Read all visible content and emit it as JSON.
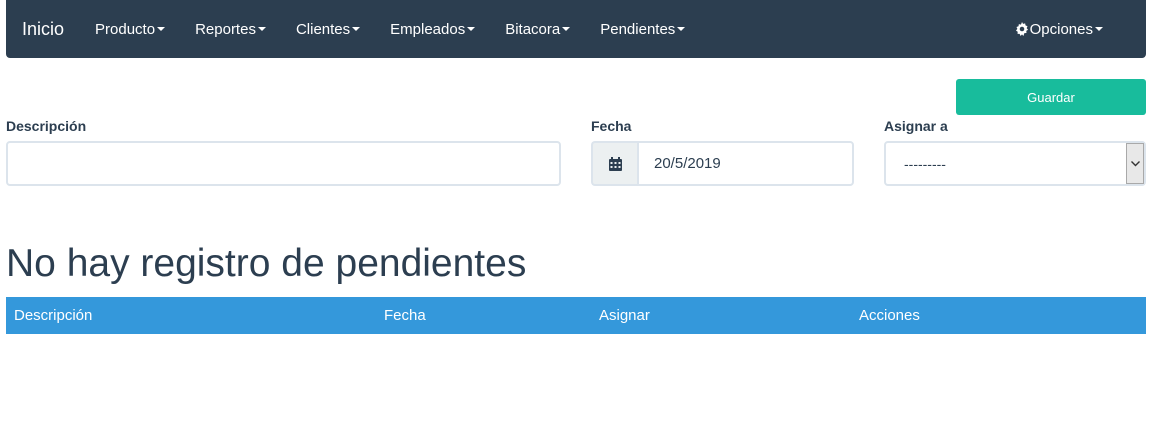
{
  "navbar": {
    "brand": "Inicio",
    "items": [
      {
        "label": "Producto"
      },
      {
        "label": "Reportes"
      },
      {
        "label": "Clientes"
      },
      {
        "label": "Empleados"
      },
      {
        "label": "Bitacora"
      },
      {
        "label": "Pendientes"
      }
    ],
    "options_label": "Opciones",
    "background": "#2c3e50"
  },
  "form": {
    "save_label": "Guardar",
    "descripcion_label": "Descripción",
    "descripcion_value": "",
    "fecha_label": "Fecha",
    "fecha_value": "20/5/2019",
    "asignar_label": "Asignar a",
    "asignar_value": "---------",
    "save_color": "#18bc9c"
  },
  "main": {
    "heading": "No hay registro de pendientes",
    "table": {
      "columns": [
        "Descripción",
        "Fecha",
        "Asignar",
        "Acciones"
      ],
      "header_color": "#3498db",
      "rows": []
    }
  }
}
